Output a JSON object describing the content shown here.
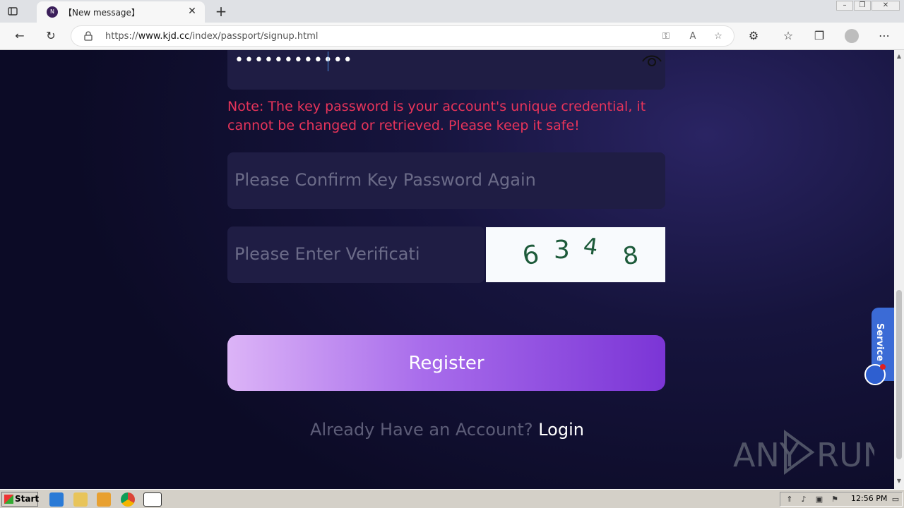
{
  "browser": {
    "tab_title": "【New message】",
    "tab_favicon_letter": "N",
    "url_prefix": "https://",
    "url_host": "www.kjd.cc",
    "url_path": "/index/passport/signup.html"
  },
  "form": {
    "password_value": "••••••••••••",
    "note": "Note: The key password is your account's unique credential, it cannot be changed or retrieved. Please keep it safe!",
    "confirm_placeholder": "Please Confirm Key Password Again",
    "verification_placeholder": "Please Enter Verification Code",
    "captcha_digits": [
      "6",
      "3",
      "4",
      "8"
    ],
    "register_label": "Register",
    "already_text": "Already Have an Account?",
    "login_link": "Login"
  },
  "widget": {
    "service_label": "Service"
  },
  "taskbar": {
    "start_label": "Start",
    "clock": "12:56 PM"
  },
  "colors": {
    "note": "#e8345a",
    "button_start": "#dcb4f7",
    "button_end": "#7b35d6",
    "captcha_ink": "#1d5a3a"
  }
}
